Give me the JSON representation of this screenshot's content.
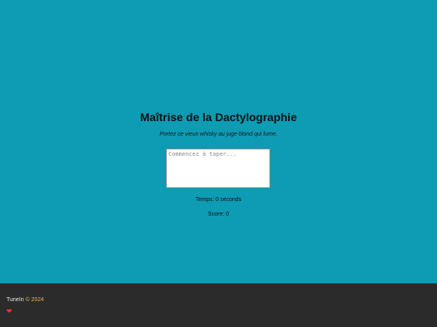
{
  "page": {
    "title": "Maîtrise de la Dactylographie",
    "pangram": "Portez ce vieux whisky au juge blond qui fume.",
    "input": {
      "placeholder": "Commencez à taper...",
      "value": ""
    },
    "time_label": "Temps: 0 seconds",
    "score_label": "Score: 0"
  },
  "footer": {
    "brand": "TuneIn",
    "copyright_symbol": "©",
    "year": "2024",
    "heart": "❤"
  },
  "colors": {
    "background": "#0e9bb4",
    "footer_bg": "#2b2b2b",
    "year_accent": "#e8b84a",
    "heart": "#e53935"
  }
}
